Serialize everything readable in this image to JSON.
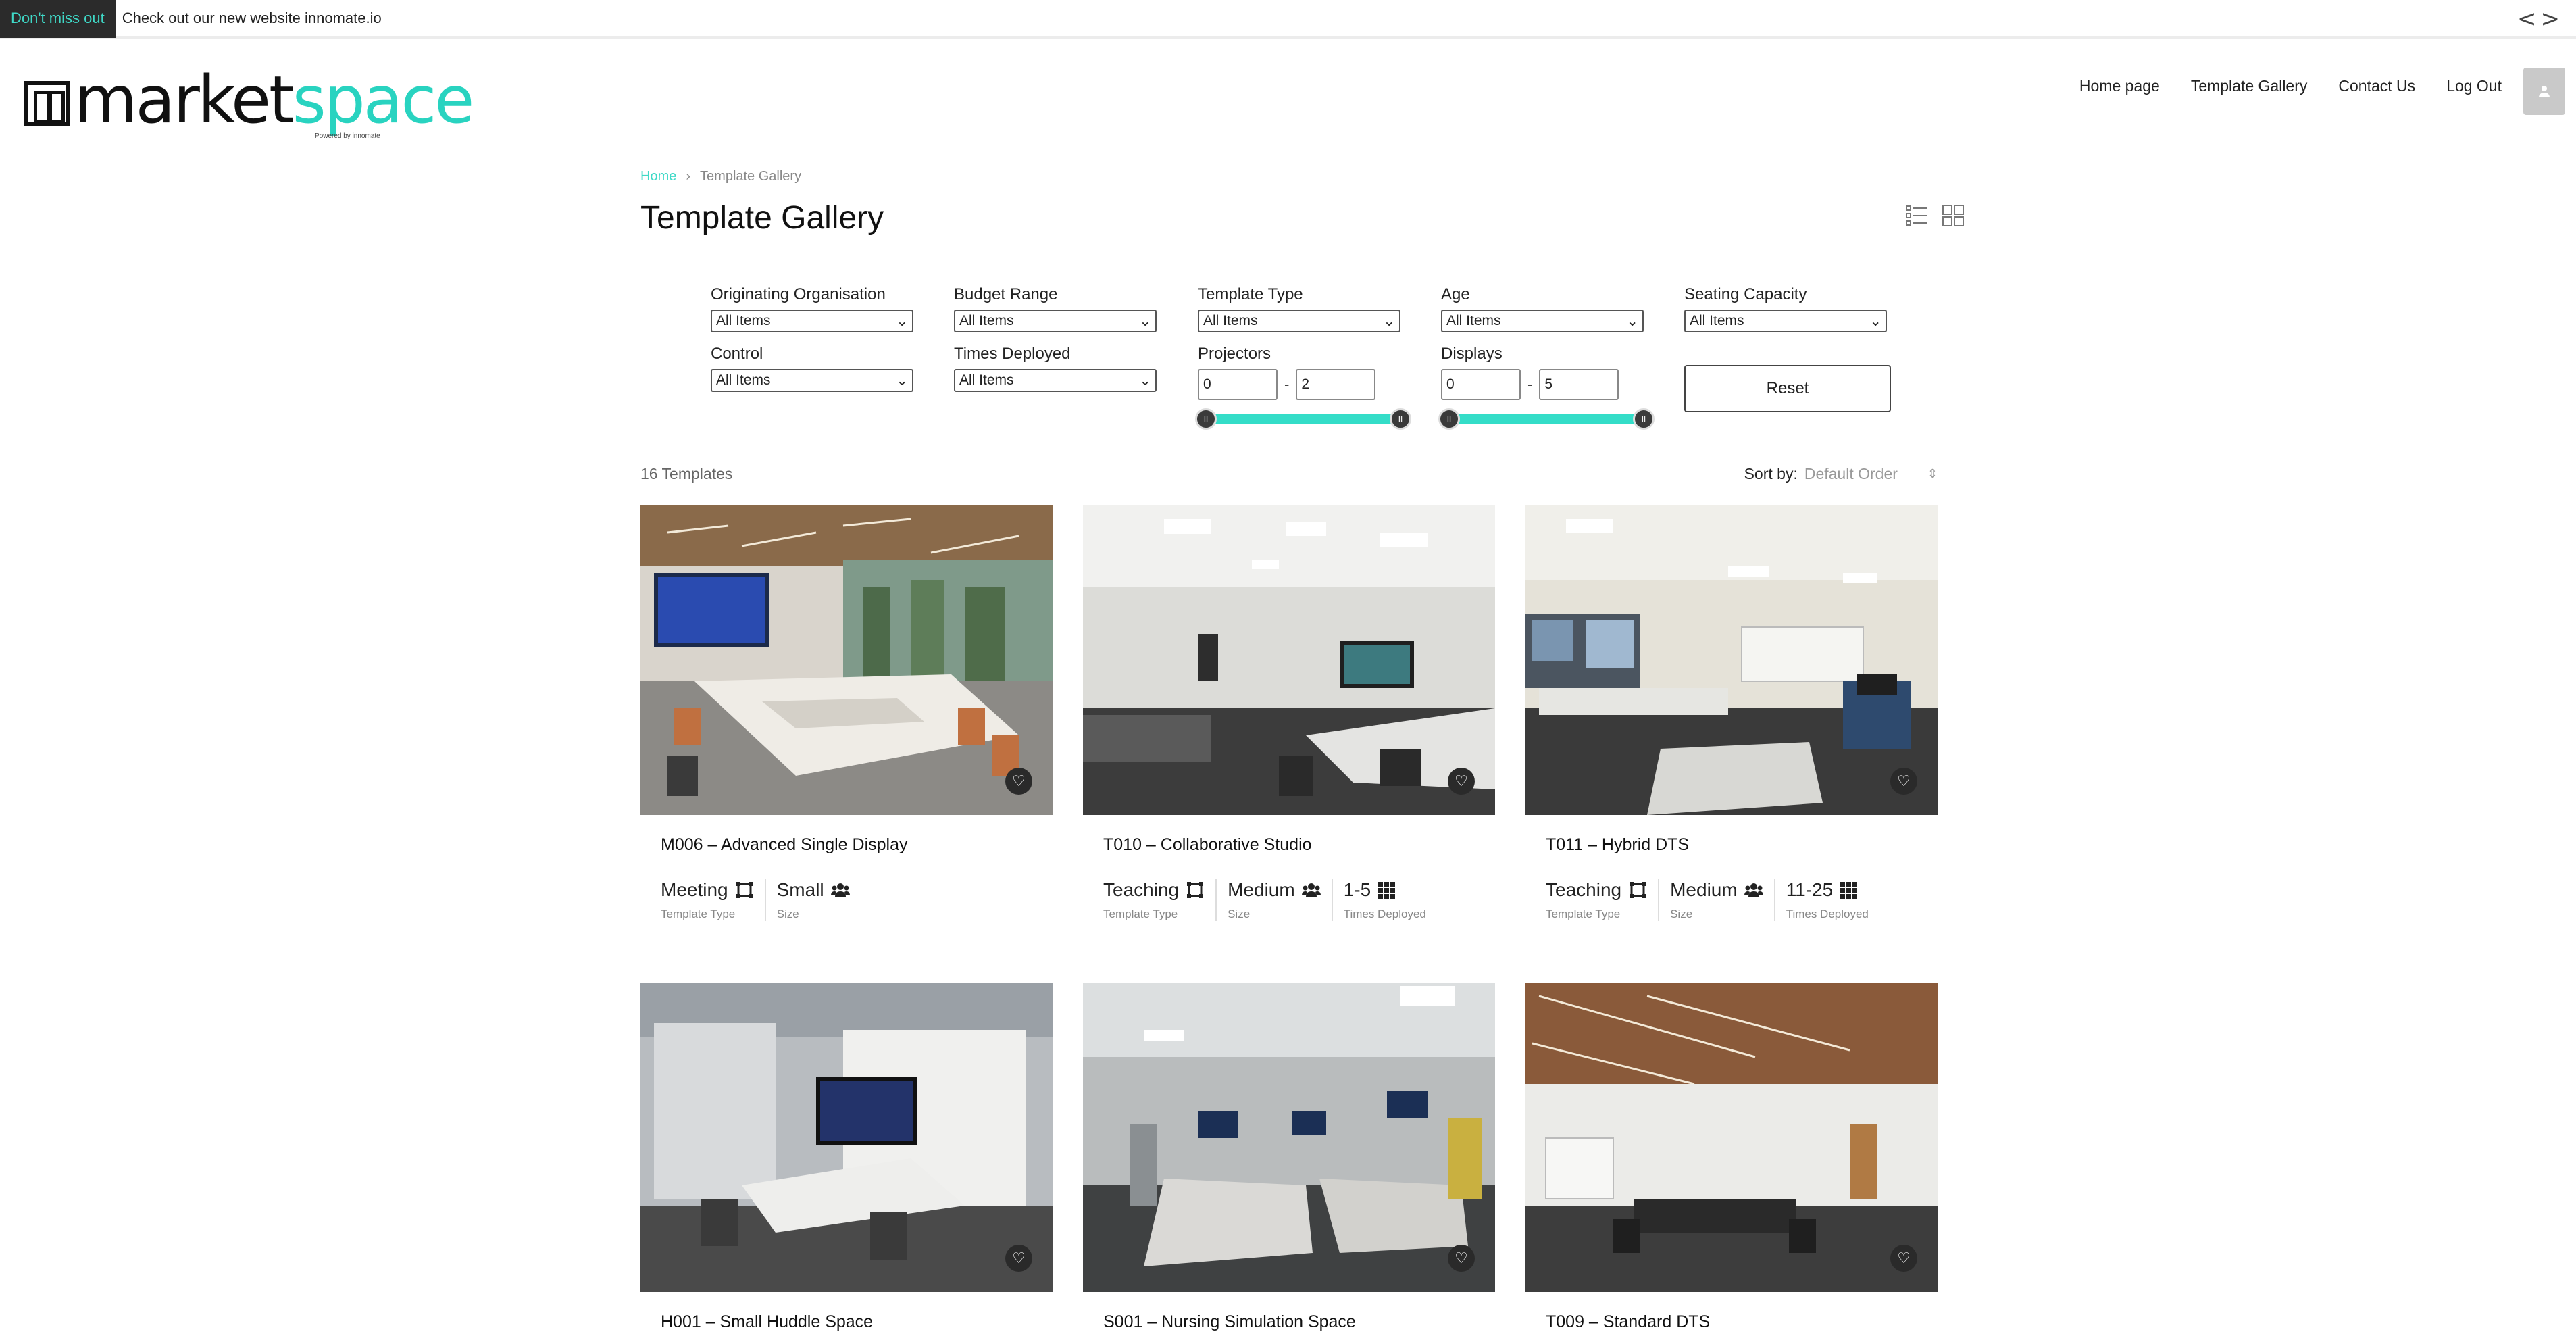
{
  "announcement": {
    "badge": "Don't miss out",
    "message": "Check out our new website innomate.io",
    "prev": "<",
    "next": ">"
  },
  "header": {
    "logo_main": "market",
    "logo_accent": "space",
    "logo_powered": "Powered by innomate",
    "nav": [
      {
        "label": "Home page"
      },
      {
        "label": "Template Gallery"
      },
      {
        "label": "Contact Us"
      },
      {
        "label": "Log Out"
      }
    ]
  },
  "breadcrumb": {
    "home": "Home",
    "separator": "›",
    "current": "Template Gallery"
  },
  "page": {
    "title": "Template Gallery"
  },
  "filters": {
    "originating_organisation": {
      "label": "Originating Organisation",
      "value": "All Items"
    },
    "budget_range": {
      "label": "Budget Range",
      "value": "All Items"
    },
    "template_type": {
      "label": "Template Type",
      "value": "All Items"
    },
    "age": {
      "label": "Age",
      "value": "All Items"
    },
    "seating_capacity": {
      "label": "Seating Capacity",
      "value": "All Items"
    },
    "control": {
      "label": "Control",
      "value": "All Items"
    },
    "times_deployed": {
      "label": "Times Deployed",
      "value": "All Items"
    },
    "projectors": {
      "label": "Projectors",
      "min": "0",
      "max": "2",
      "dash": "-"
    },
    "displays": {
      "label": "Displays",
      "min": "0",
      "max": "5",
      "dash": "-"
    },
    "reset_label": "Reset"
  },
  "results": {
    "count": "16 Templates",
    "sort_label": "Sort by:",
    "sort_value": "Default Order"
  },
  "cards": [
    {
      "title": "M006 – Advanced Single Display",
      "type": "Meeting",
      "type_label": "Template Type",
      "size": "Small",
      "size_label": "Size"
    },
    {
      "title": "T010 – Collaborative Studio",
      "type": "Teaching",
      "type_label": "Template Type",
      "size": "Medium",
      "size_label": "Size",
      "deployed": "1-5",
      "deployed_label": "Times Deployed"
    },
    {
      "title": "T011 – Hybrid DTS",
      "type": "Teaching",
      "type_label": "Template Type",
      "size": "Medium",
      "size_label": "Size",
      "deployed": "11-25",
      "deployed_label": "Times Deployed"
    },
    {
      "title": "H001 – Small Huddle Space"
    },
    {
      "title": "S001 – Nursing Simulation Space"
    },
    {
      "title": "T009 – Standard DTS"
    }
  ],
  "colors": {
    "accent": "#34ddc8",
    "dark": "#2b2b2b"
  }
}
